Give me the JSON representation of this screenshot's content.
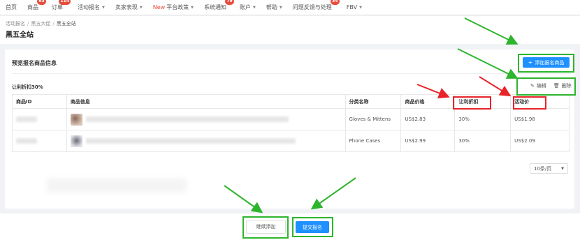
{
  "nav": {
    "items": [
      {
        "label": "首页",
        "badge": "",
        "caret": false,
        "new": ""
      },
      {
        "label": "商品",
        "badge": "63",
        "caret": false,
        "new": ""
      },
      {
        "label": "订单",
        "badge": "114",
        "caret": false,
        "new": ""
      },
      {
        "label": "活动报名",
        "badge": "",
        "caret": true,
        "new": ""
      },
      {
        "label": "卖家表现",
        "badge": "",
        "caret": true,
        "new": ""
      },
      {
        "label": "平台政策",
        "badge": "",
        "caret": true,
        "new": "New"
      },
      {
        "label": "系统通知",
        "badge": "79",
        "caret": false,
        "new": ""
      },
      {
        "label": "账户",
        "badge": "",
        "caret": true,
        "new": ""
      },
      {
        "label": "帮助",
        "badge": "",
        "caret": true,
        "new": ""
      },
      {
        "label": "问题反馈与处理",
        "badge": "34",
        "caret": false,
        "new": ""
      },
      {
        "label": "FBV",
        "badge": "",
        "caret": true,
        "new": ""
      }
    ]
  },
  "breadcrumb": {
    "items": [
      "活动报名",
      "黑五大促",
      "黑五全站"
    ],
    "sep": "/"
  },
  "page_title": "黑五全站",
  "card": {
    "title": "预览报名商品信息",
    "add_button": "添加报名商品",
    "add_icon": "+",
    "discount_label": "让利折扣30%",
    "edit_label": "编辑",
    "edit_icon": "✎",
    "delete_label": "删除",
    "delete_icon": "🗑"
  },
  "table": {
    "headers": [
      "商品ID",
      "商品信息",
      "分类名称",
      "商品价格",
      "让利折扣",
      "活动价"
    ],
    "rows": [
      {
        "category": "Gloves & Mittens",
        "price": "US$2.83",
        "discount": "30%",
        "activity_price": "US$1.98"
      },
      {
        "category": "Phone Cases",
        "price": "US$2.99",
        "discount": "30%",
        "activity_price": "US$2.09"
      }
    ]
  },
  "pagination": {
    "page_size": "10条/页",
    "caret": "▼"
  },
  "footer": {
    "continue_button": "继续添加",
    "submit_button": "提交报名"
  },
  "colors": {
    "primary": "#1e90ff",
    "badge": "#e74c3c",
    "annotation_green": "#2db52d",
    "annotation_red": "#e8232a"
  }
}
